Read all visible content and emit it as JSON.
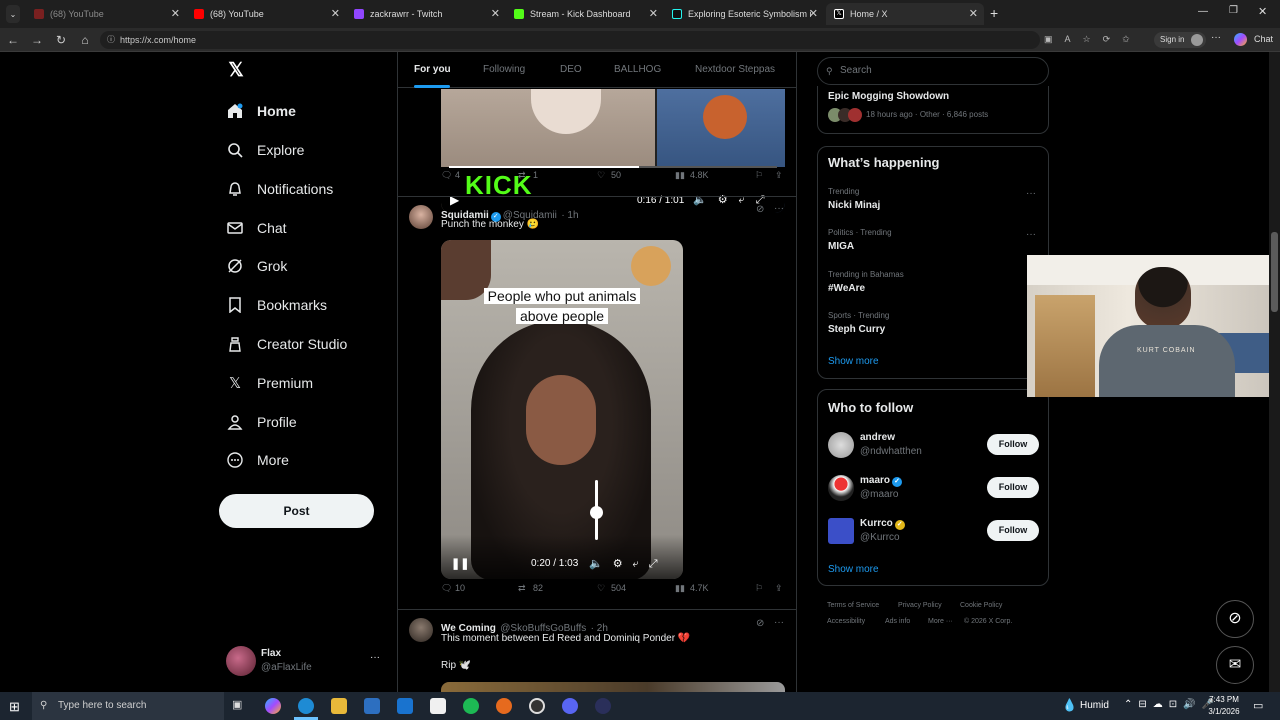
{
  "browser": {
    "tabs": [
      {
        "label": "(68) YouTube",
        "color": "#c4302b"
      },
      {
        "label": "(68) YouTube",
        "color": "#ff0000"
      },
      {
        "label": "zackrawrr - Twitch",
        "color": "#9146ff"
      },
      {
        "label": "Stream - Kick Dashboard",
        "color": "#53fc18"
      },
      {
        "label": "Exploring Esoteric Symbolism in M",
        "color": "#25f4ee"
      },
      {
        "label": "Home / X",
        "color": "#ffffff"
      }
    ],
    "url": "https://x.com/home",
    "signin_label": "Sign in",
    "chat_label": "Chat"
  },
  "nav": {
    "items": [
      {
        "label": "Home",
        "icon": "home-icon"
      },
      {
        "label": "Explore",
        "icon": "search-icon"
      },
      {
        "label": "Notifications",
        "icon": "bell-icon"
      },
      {
        "label": "Chat",
        "icon": "mail-icon"
      },
      {
        "label": "Grok",
        "icon": "grok-icon"
      },
      {
        "label": "Bookmarks",
        "icon": "bookmark-icon"
      },
      {
        "label": "Creator Studio",
        "icon": "creator-icon"
      },
      {
        "label": "Premium",
        "icon": "x-icon"
      },
      {
        "label": "Profile",
        "icon": "person-icon"
      },
      {
        "label": "More",
        "icon": "more-circle-icon"
      }
    ],
    "post_label": "Post",
    "account": {
      "name": "Flax",
      "handle": "@aFlaxLife"
    }
  },
  "feed": {
    "tabs": [
      "For you",
      "Following",
      "DEO",
      "BALLHOG",
      "Nextdoor Steppas"
    ],
    "post1": {
      "video_time": "0:16 / 1:01",
      "video_brand": "KICK",
      "replies": "4",
      "reposts": "1",
      "likes": "50",
      "views": "4.8K"
    },
    "post2": {
      "name": "Squidamii",
      "handle": "@Squidamii",
      "time": "· 1h",
      "text": "Punch the monkey 🥲",
      "caption": "People who put animals above people",
      "video_time": "0:20 / 1:03",
      "replies": "10",
      "reposts": "82",
      "likes": "504",
      "views": "4.7K"
    },
    "post3": {
      "name": "We Coming",
      "handle": "@SkoBuffsGoBuffs",
      "time": "· 2h",
      "text": "This moment between Ed Reed and Dominiq Ponder 💔",
      "text2": "Rip 🕊️"
    }
  },
  "right": {
    "search_placeholder": "Search",
    "top_card": {
      "title": "Epic Mogging Showdown",
      "meta": "18 hours ago · Other · 6,846 posts"
    },
    "happening": {
      "title": "What’s happening",
      "trends": [
        {
          "meta": "Trending",
          "name": "Nicki Minaj"
        },
        {
          "meta": "Politics · Trending",
          "name": "MIGA"
        },
        {
          "meta": "Trending in Bahamas",
          "name": "#WeAre"
        },
        {
          "meta": "Sports · Trending",
          "name": "Steph Curry"
        }
      ],
      "show_more": "Show more"
    },
    "follow": {
      "title": "Who to follow",
      "users": [
        {
          "name": "andrew",
          "handle": "@ndwhatthen",
          "button": "Follow"
        },
        {
          "name": "maaro",
          "handle": "@maaro",
          "button": "Follow"
        },
        {
          "name": "Kurrco",
          "handle": "@Kurrco",
          "button": "Follow"
        }
      ],
      "show_more": "Show more"
    },
    "footer": [
      "Terms of Service",
      "Privacy Policy",
      "Cookie Policy",
      "Accessibility",
      "Ads info",
      "More ···",
      "© 2026 X Corp."
    ]
  },
  "webcam": {
    "shirt_text": "KURT COBAIN"
  },
  "taskbar": {
    "search_placeholder": "Type here to search",
    "weather": "Humid",
    "time": "7:43 PM",
    "date": "3/1/2026"
  }
}
